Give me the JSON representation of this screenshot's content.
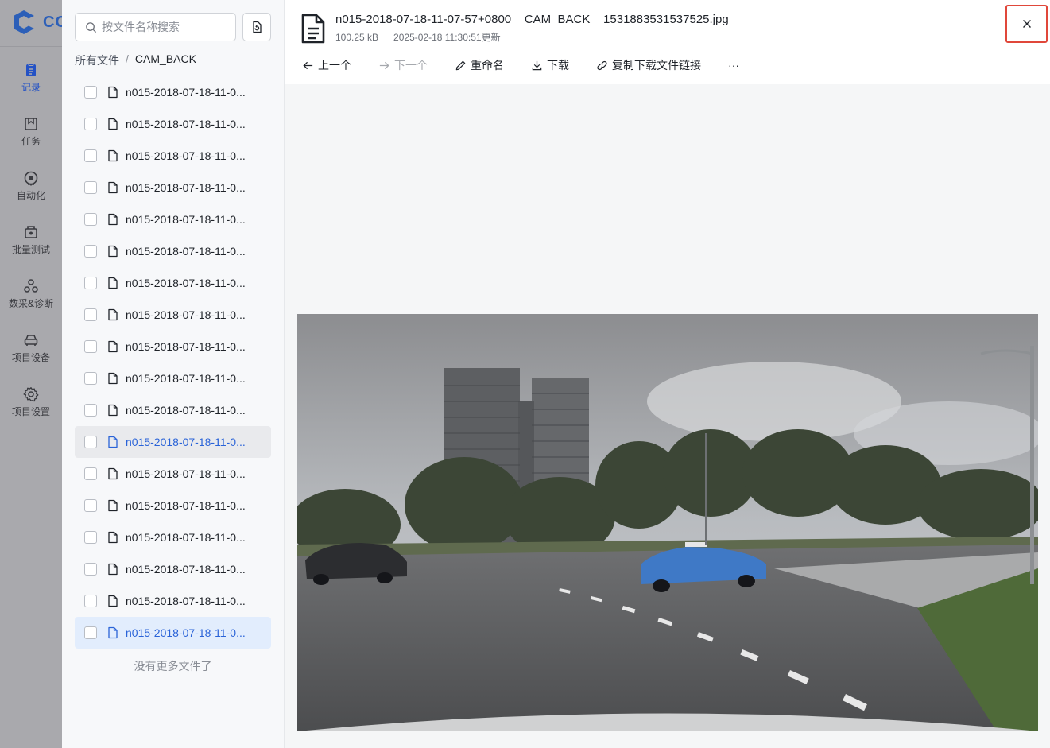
{
  "brand": {
    "logo_text": "CO"
  },
  "nav": {
    "items": [
      {
        "label": "记录",
        "icon": "record-icon",
        "active": true
      },
      {
        "label": "任务",
        "icon": "task-icon",
        "active": false
      },
      {
        "label": "自动化",
        "icon": "automation-icon",
        "active": false
      },
      {
        "label": "批量测试",
        "icon": "batch-test-icon",
        "active": false
      },
      {
        "label": "数采&诊断",
        "icon": "diagnosis-icon",
        "active": false
      },
      {
        "label": "项目设备",
        "icon": "device-icon",
        "active": false
      },
      {
        "label": "项目设置",
        "icon": "gear-icon",
        "active": false
      }
    ]
  },
  "files": {
    "search_placeholder": "按文件名称搜索",
    "breadcrumb": {
      "root": "所有文件",
      "separator": "/",
      "current": "CAM_BACK"
    },
    "items": [
      "n015-2018-07-18-11-0...",
      "n015-2018-07-18-11-0...",
      "n015-2018-07-18-11-0...",
      "n015-2018-07-18-11-0...",
      "n015-2018-07-18-11-0...",
      "n015-2018-07-18-11-0...",
      "n015-2018-07-18-11-0...",
      "n015-2018-07-18-11-0...",
      "n015-2018-07-18-11-0...",
      "n015-2018-07-18-11-0...",
      "n015-2018-07-18-11-0...",
      "n015-2018-07-18-11-0...",
      "n015-2018-07-18-11-0...",
      "n015-2018-07-18-11-0...",
      "n015-2018-07-18-11-0...",
      "n015-2018-07-18-11-0...",
      "n015-2018-07-18-11-0...",
      "n015-2018-07-18-11-0..."
    ],
    "hover_index": 11,
    "selected_index": 17,
    "no_more": "没有更多文件了"
  },
  "preview": {
    "title": "n015-2018-07-18-11-07-57+0800__CAM_BACK__1531883531537525.jpg",
    "size": "100.25 kB",
    "updated": "2025-02-18 11:30:51更新",
    "toolbar": {
      "prev": "上一个",
      "next": "下一个",
      "rename": "重命名",
      "download": "下载",
      "copy_link": "复制下载文件链接",
      "more": "···"
    },
    "close": "×"
  },
  "colors": {
    "accent": "#2a63d8",
    "close_border": "#e0473a",
    "nav_bg": "#a9a9ad"
  }
}
